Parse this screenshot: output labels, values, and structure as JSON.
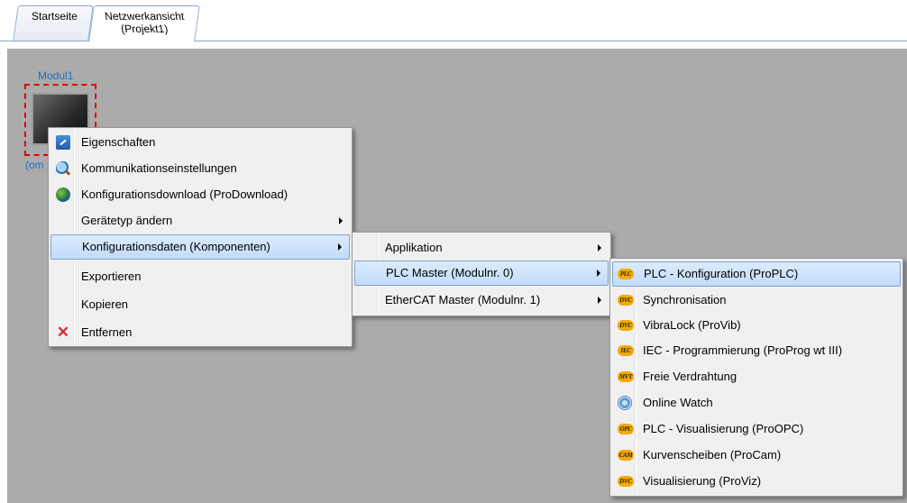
{
  "tabs": [
    {
      "label": "Startseite"
    },
    {
      "label_line1": "Netzwerkansicht",
      "label_line2": "(Projekt1)"
    }
  ],
  "module": {
    "name": "Modul1",
    "sublabel": "(om"
  },
  "context_menu": {
    "items": [
      {
        "label": "Eigenschaften",
        "icon": "properties-icon"
      },
      {
        "label": "Kommunikationseinstellungen",
        "icon": "magnifier-icon"
      },
      {
        "label": "Konfigurationsdownload (ProDownload)",
        "icon": "globe-icon"
      },
      {
        "label": "Gerätetyp ändern",
        "has_submenu": true
      },
      {
        "label": "Konfigurationsdaten (Komponenten)",
        "has_submenu": true,
        "highlighted": true
      },
      {
        "label": "Exportieren"
      },
      {
        "label": "Kopieren"
      },
      {
        "label": "Entfernen",
        "icon": "delete-icon"
      }
    ]
  },
  "submenu_components": {
    "items": [
      {
        "label": "Applikation",
        "has_submenu": true
      },
      {
        "label": "PLC Master (Modulnr. 0)",
        "has_submenu": true,
        "highlighted": true
      },
      {
        "label": "EtherCAT Master (Modulnr. 1)",
        "has_submenu": true
      }
    ]
  },
  "submenu_plc": {
    "items": [
      {
        "label": "PLC - Konfiguration (ProPLC)",
        "badge": "PLC",
        "highlighted": true
      },
      {
        "label": "Synchronisation",
        "badge": "DVC"
      },
      {
        "label": "VibraLock (ProVib)",
        "badge": "DVC"
      },
      {
        "label": "IEC - Programmierung (ProProg wt III)",
        "badge": "IEC"
      },
      {
        "label": "Freie Verdrahtung",
        "badge": "MVT"
      },
      {
        "label": "Online Watch",
        "badge": "watch"
      },
      {
        "label": "PLC - Visualisierung (ProOPC)",
        "badge": "OPC"
      },
      {
        "label": "Kurvenscheiben (ProCam)",
        "badge": "CAM"
      },
      {
        "label": "Visualisierung (ProViz)",
        "badge": "DVC"
      }
    ]
  },
  "colors": {
    "workspace": "#ababab",
    "menu_bg": "#f0f0f0",
    "highlight": "#c1dcfc",
    "module_label": "#1e6ec8",
    "selection_border": "#e00000",
    "badge": "#f2a900"
  }
}
